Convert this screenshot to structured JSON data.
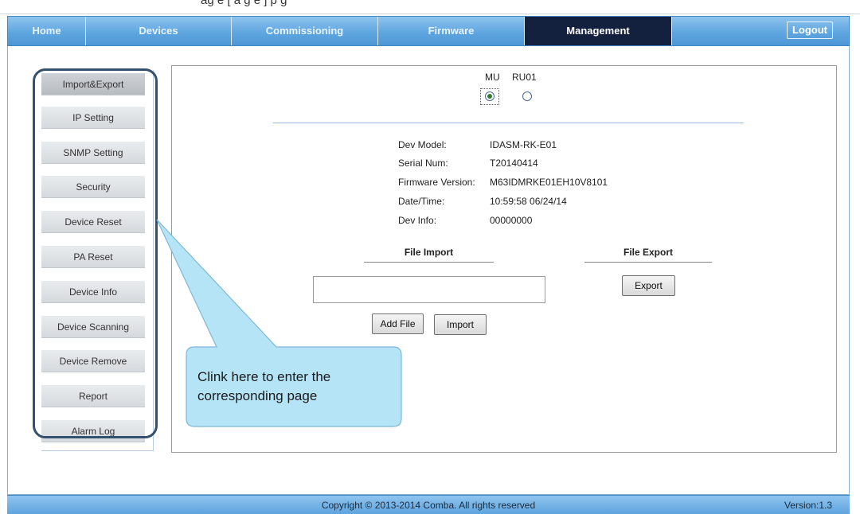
{
  "top_strip": {
    "partial_text": "ag e   [  a g e  ]  p g"
  },
  "nav": {
    "items": [
      {
        "label": "Home"
      },
      {
        "label": "Devices"
      },
      {
        "label": "Commissioning"
      },
      {
        "label": "Firmware"
      },
      {
        "label": "Management"
      }
    ],
    "active": "Management",
    "logout_label": "Logout"
  },
  "sidebar": {
    "items": [
      {
        "label": "Import&Export"
      },
      {
        "label": "IP Setting"
      },
      {
        "label": "SNMP Setting"
      },
      {
        "label": "Security"
      },
      {
        "label": "Device Reset"
      },
      {
        "label": "PA Reset"
      },
      {
        "label": "Device Info"
      },
      {
        "label": "Device Scanning"
      },
      {
        "label": "Device Remove"
      },
      {
        "label": "Report"
      },
      {
        "label": "Alarm Log"
      }
    ],
    "active": "Import&Export"
  },
  "unit_select": {
    "options": [
      {
        "label": "MU",
        "checked": true
      },
      {
        "label": "RU01",
        "checked": false
      }
    ]
  },
  "device_info": {
    "model_label": "Dev Model:",
    "model_value": "IDASM-RK-E01",
    "serial_label": "Serial Num:",
    "serial_value": "T20140414",
    "firmware_label": "Firmware Version:",
    "firmware_value": "M63IDMRKE01EH10V8101",
    "datetime_label": "Date/Time:",
    "datetime_value": "10:59:58 06/24/14",
    "info_label": "Dev Info:",
    "info_value": "00000000"
  },
  "file_import": {
    "title": "File Import",
    "file_value": "",
    "add_file_label": "Add File",
    "import_label": "Import"
  },
  "file_export": {
    "title": "File Export",
    "export_label": "Export"
  },
  "callout": {
    "line1": "Clink here to enter the",
    "line2": "corresponding page"
  },
  "footer": {
    "copyright": "Copyright © 2013-2014 Comba. All rights reserved",
    "version": "Version:1.3"
  },
  "colors": {
    "nav_blue": "#5fa6e0",
    "nav_active": "#13213f",
    "callout_fill": "#b6e4f7",
    "highlight_border": "#34506f"
  }
}
